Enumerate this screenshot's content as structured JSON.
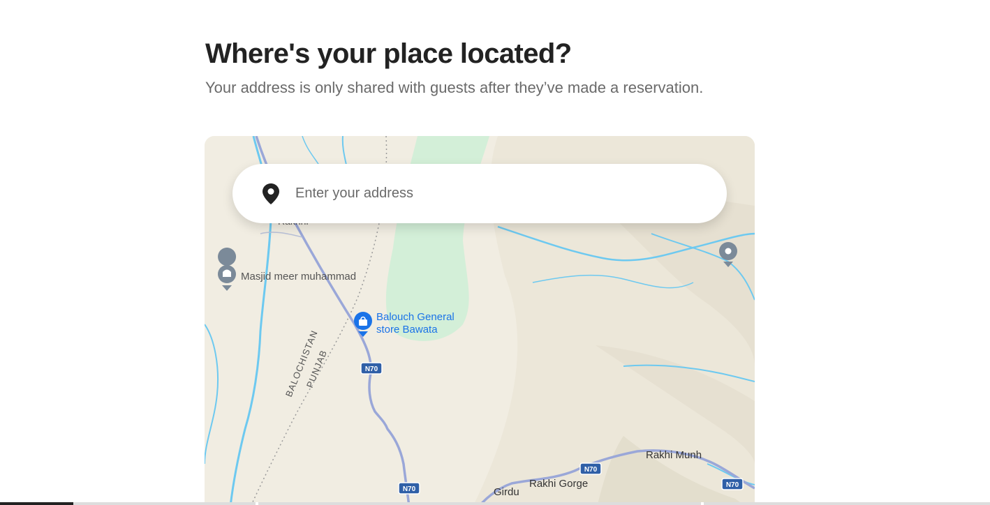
{
  "header": {
    "title": "Where's your place located?",
    "subtitle": "Your address is only shared with guests after they’ve made a reservation."
  },
  "address_search": {
    "placeholder": "Enter your address",
    "icon": "location-pin-icon"
  },
  "map": {
    "labels": {
      "rakhni": "Rakhni",
      "masjid": "Masjid meer muhammad",
      "store_line1": "Balouch General",
      "store_line2": "store Bawata",
      "balochistan": "BALOCHISTAN",
      "punjab": "PUNJAB",
      "n70": "N70",
      "rakhi_munh": "Rakhi Munh",
      "rakhi_gorge": "Rakhi Gorge",
      "girdu": "Girdu"
    },
    "colors": {
      "land": "#f1ede2",
      "park": "#d3efd8",
      "water": "#6dc9f0",
      "road": "#9aa7d8",
      "poi_blue": "#1a73e8",
      "poi_gray": "#7b8a99"
    }
  },
  "progress": {
    "fraction": 0.074
  }
}
